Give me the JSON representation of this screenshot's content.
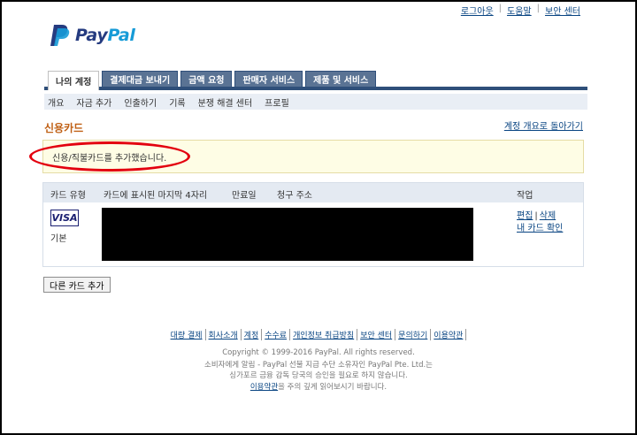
{
  "header": {
    "top_links": [
      "로그아웃",
      "도움말",
      "보안 센터"
    ],
    "logo": {
      "pay": "Pay",
      "pal": "Pal"
    }
  },
  "tabs": [
    {
      "label": "나의 계정",
      "active": true
    },
    {
      "label": "결제대금 보내기",
      "active": false
    },
    {
      "label": "금액 요청",
      "active": false
    },
    {
      "label": "판매자 서비스",
      "active": false
    },
    {
      "label": "제품 및 서비스",
      "active": false
    }
  ],
  "subnav": [
    "개요",
    "자금 추가",
    "인출하기",
    "기록",
    "분쟁 해결 센터",
    "프로필"
  ],
  "main": {
    "title": "신용카드",
    "back_link": "계정 개요로 돌아가기",
    "notice": "신용/직불카드를 추가했습니다.",
    "table": {
      "headers": [
        "카드 유형",
        "카드에 표시된 마지막 4자리",
        "만료일",
        "청구 주소",
        "작업"
      ],
      "row": {
        "card_brand": "VISA",
        "card_status": "기본",
        "actions": {
          "edit": "편집",
          "separator": "|",
          "delete": "삭제",
          "verify": "내 카드 확인"
        }
      }
    },
    "add_card_button": "다른 카드 추가"
  },
  "footer": {
    "links": [
      "대량 결제",
      "회사소개",
      "계정",
      "수수료",
      "개인정보 취급방침",
      "보안 센터",
      "문의하기",
      "이용약관"
    ],
    "copyright": "Copyright © 1999-2016 PayPal. All rights reserved.",
    "notice_line1": "소비자에게 알림 - PayPal 선불 지급 수단 소유자인 PayPal Pte. Ltd.는",
    "notice_line2": "싱가포르 금융 감독 당국의 승인을 필요로 하지 않습니다.",
    "terms_link": "이용약관",
    "terms_suffix": "을 주의 깊게 읽어보시기 바랍니다."
  },
  "colors": {
    "tab_bar": "#2f4f7a",
    "title": "#c06015",
    "link": "#084482",
    "notice_bg": "#fefde5",
    "highlight_ellipse": "#e3000f"
  }
}
